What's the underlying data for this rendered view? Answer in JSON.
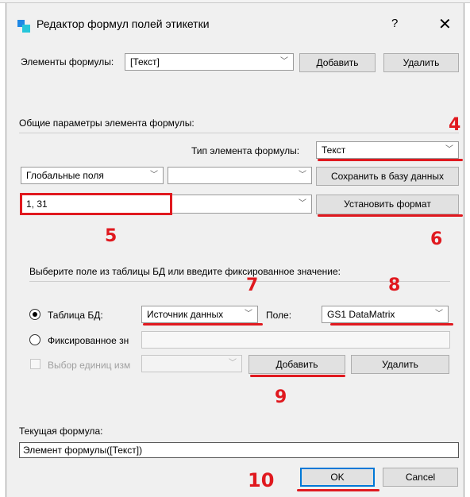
{
  "window": {
    "title": "Редактор формул полей этикетки",
    "help": "?",
    "close": "✕"
  },
  "formula_elements": {
    "label": "Элементы формулы:",
    "value": "[Текст]",
    "add_button": "Добавить",
    "delete_button": "Удалить"
  },
  "general": {
    "header": "Общие параметры элемента формулы:",
    "type_label": "Тип элемента формулы:",
    "type_value": "Текст",
    "global_fields": "Глобальные поля",
    "second_combo": "",
    "save_db_button": "Сохранить в базу данных",
    "format_value": "1, 31",
    "set_format_button": "Установить формат"
  },
  "source": {
    "header": "Выберите поле из таблицы БД или введите фиксированное значение:",
    "table_radio": "Таблица БД:",
    "datasource": "Источник данных",
    "field_label": "Поле:",
    "field_value": "GS1 DataMatrix",
    "fixed_radio": "Фиксированное зн",
    "units_check": "Выбор единиц изм",
    "add_button": "Добавить",
    "delete_button": "Удалить"
  },
  "current": {
    "label": "Текущая формула:",
    "value": "Элемент формулы([Текст])"
  },
  "footer": {
    "ok": "OK",
    "cancel": "Cancel"
  },
  "annotations": {
    "n4": "4",
    "n5": "5",
    "n6": "6",
    "n7": "7",
    "n8": "8",
    "n9": "9",
    "n10": "10"
  },
  "colors": {
    "annotation": "#e0191f",
    "accent": "#0078d7"
  }
}
